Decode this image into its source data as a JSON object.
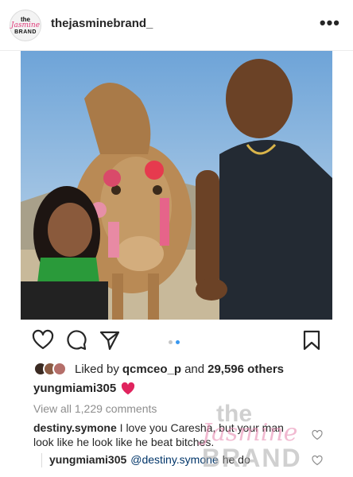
{
  "header": {
    "avatar_line1": "the",
    "avatar_line2": "Jasmine",
    "avatar_line3": "BRAND",
    "username": "thejasminebrand_",
    "more_icon": "•••"
  },
  "photo": {
    "subject": "camel-selfie"
  },
  "carousel": {
    "count": 2,
    "active": 1
  },
  "likes": {
    "prefix": "Liked by",
    "user": "qcmceo_p",
    "sep": "and",
    "others": "29,596 others"
  },
  "caption": {
    "user": "yungmiami305",
    "emoji": "❤️"
  },
  "view_all": "View all 1,229 comments",
  "comment": {
    "user": "destiny.symone",
    "text": "I love you Caresha, but your man look like he look like he beat bitches."
  },
  "reply": {
    "user": "yungmiami305",
    "mention": "@destiny.symone",
    "text": "he do"
  },
  "watermark": {
    "line1": "the",
    "line2": "Jasmine",
    "line3": "BRAND"
  },
  "colors": {
    "accent": "#3897f0",
    "heart": "#ed4956",
    "muted": "#8e8e8e",
    "watermark_pink": "#e8a0be"
  },
  "icons": [
    "heart-icon",
    "comment-icon",
    "share-icon",
    "bookmark-icon",
    "more-icon",
    "red-heart-emoji"
  ]
}
